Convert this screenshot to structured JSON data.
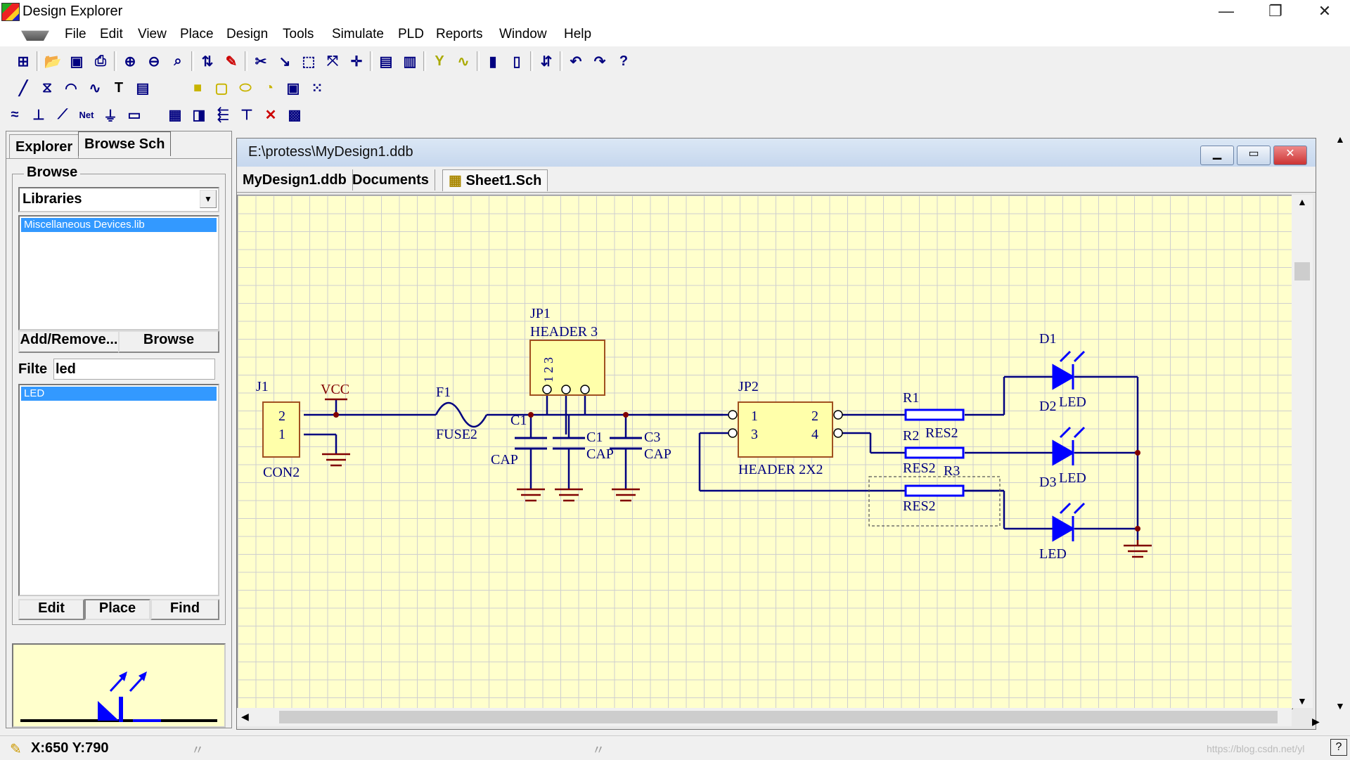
{
  "window": {
    "title": "Design Explorer",
    "min": "—",
    "max": "❐",
    "close": "✕"
  },
  "menu": [
    "File",
    "Edit",
    "View",
    "Place",
    "Design",
    "Tools",
    "Simulate",
    "PLD",
    "Reports",
    "Window",
    "Help"
  ],
  "left_panel": {
    "tabs": [
      "Explorer",
      "Browse Sch"
    ],
    "browse_label": "Browse",
    "browse_select": "Libraries",
    "libraries": [
      "Miscellaneous Devices.lib"
    ],
    "add_remove": "Add/Remove...",
    "browse_button": "Browse",
    "filter_label": "Filte",
    "filter_value": "led",
    "components": [
      "LED"
    ],
    "edit": "Edit",
    "place": "Place",
    "find": "Find"
  },
  "document": {
    "path": "E:\\protess\\MyDesign1.ddb",
    "tabs": [
      "MyDesign1.ddb",
      "Documents",
      "Sheet1.Sch"
    ]
  },
  "schematic": {
    "J1": {
      "ref": "J1",
      "type": "CON2",
      "pins": [
        "2",
        "1"
      ]
    },
    "VCC": "VCC",
    "F1": {
      "ref": "F1",
      "type": "FUSE2"
    },
    "JP1": {
      "ref": "JP1",
      "type": "HEADER 3",
      "pins": "1 2 3"
    },
    "C1a": {
      "ref": "C1",
      "type": "CAP"
    },
    "C1b": {
      "ref": "C1",
      "type": "CAP"
    },
    "C3": {
      "ref": "C3",
      "type": "CAP"
    },
    "JP2": {
      "ref": "JP2",
      "type": "HEADER 2X2",
      "pins": [
        "1",
        "2",
        "3",
        "4"
      ]
    },
    "R1": {
      "ref": "R1",
      "type": "RES2"
    },
    "R2": {
      "ref": "R2",
      "type": "RES2"
    },
    "R3": {
      "ref": "R3",
      "type": "RES2"
    },
    "D1": {
      "ref": "D1",
      "type": "LED"
    },
    "D2": {
      "ref": "D2",
      "type": "LED"
    },
    "D3": {
      "ref": "D3",
      "type": "LED"
    }
  },
  "status": {
    "coords": "X:650 Y:790",
    "watermark": "https://blog.csdn.net/yl"
  }
}
